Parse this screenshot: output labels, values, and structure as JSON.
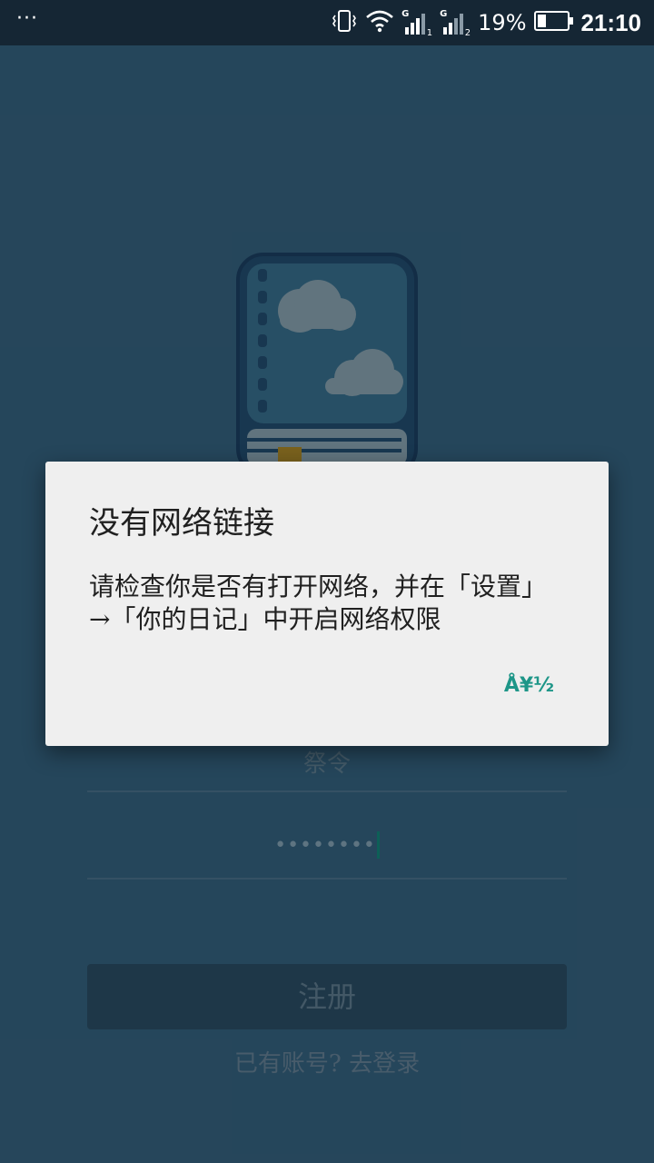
{
  "status_bar": {
    "menu_dots": "···",
    "sim1_label": "G",
    "sim1_index": "1",
    "sim2_label": "G",
    "sim2_index": "2",
    "battery_percent": "19%",
    "time": "21:10",
    "icons": [
      "vibrate-icon",
      "wifi-icon",
      "signal-icon",
      "battery-icon"
    ]
  },
  "form": {
    "field1_placeholder": "祭令",
    "password_value": "••••••••",
    "register_label": "注册",
    "login_link": "已有账号? 去登录"
  },
  "dialog": {
    "title": "没有网络链接",
    "message": "请检查你是否有打开网络，并在「设置」\n→「你的日记」中开启网络权限",
    "ok_label": "Å¥½"
  },
  "colors": {
    "background": "#2b5068",
    "status_bar": "#152634",
    "dialog_bg": "#efefef",
    "accent": "#1e9688"
  }
}
